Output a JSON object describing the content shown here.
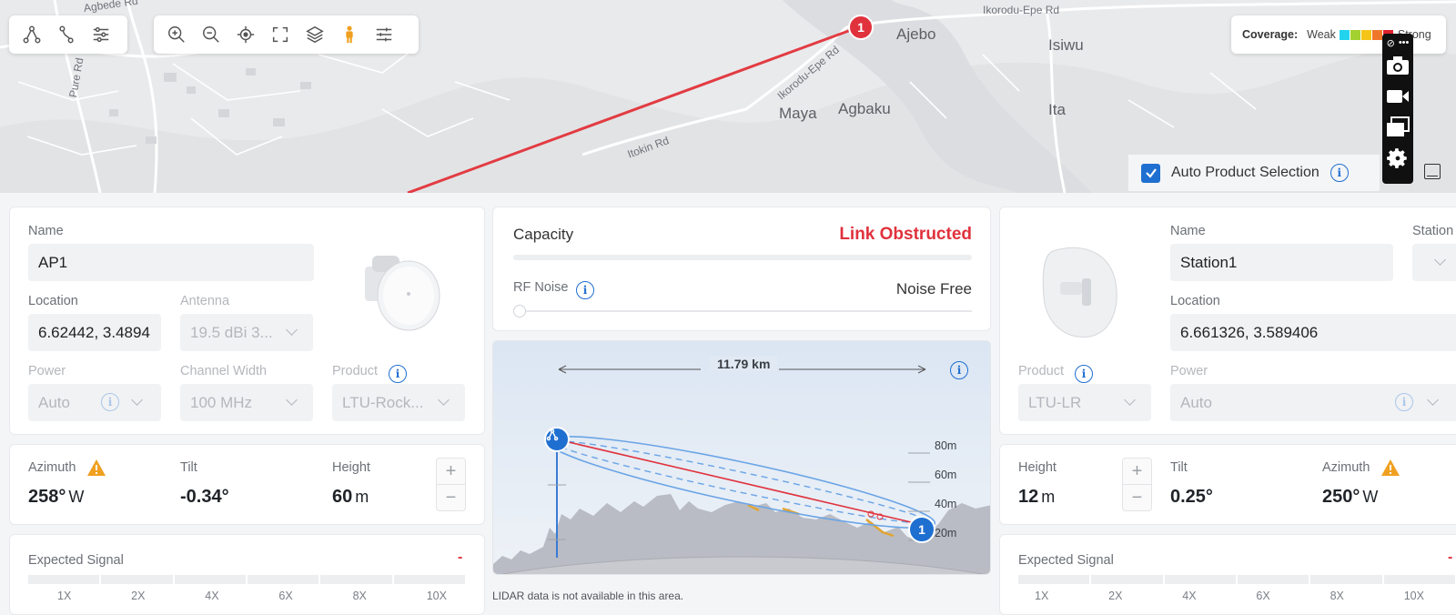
{
  "map": {
    "places": [
      "Ajebo",
      "Isiwu",
      "Maya",
      "Agbaku",
      "Ita"
    ],
    "roads": [
      "Ikorodu-Epe Rd",
      "Ikorodu-Epe Rd",
      "Itokin Rd",
      "Agbede Rd",
      "Pure Rd"
    ],
    "marker": "1"
  },
  "toolbar_left": {
    "icons": [
      "network-icon",
      "link-icon",
      "filter-icon"
    ]
  },
  "toolbar_right": {
    "icons": [
      "zoom-in-icon",
      "zoom-out-icon",
      "locate-icon",
      "fullscreen-icon",
      "layers-icon",
      "street-view-icon",
      "settings-sliders-icon"
    ]
  },
  "coverage": {
    "title": "Coverage:",
    "weak": "Weak",
    "strong": "Strong",
    "colors": [
      "#22d3ee",
      "#a3d12f",
      "#f5c518",
      "#f0772a",
      "#e0222b"
    ]
  },
  "auto_product": {
    "label": "Auto Product Selection",
    "checked": true
  },
  "ap": {
    "name_label": "Name",
    "name": "AP1",
    "location_label": "Location",
    "location": "6.62442, 3.4894",
    "antenna_label": "Antenna",
    "antenna": "19.5 dBi 3...",
    "power_label": "Power",
    "power": "Auto",
    "channel_label": "Channel Width",
    "channel": "100 MHz",
    "product_label": "Product",
    "product": "LTU-Rock...",
    "azimuth_label": "Azimuth",
    "azimuth": "258°",
    "azimuth_dir": "W",
    "tilt_label": "Tilt",
    "tilt": "-0.34°",
    "height_label": "Height",
    "height": "60",
    "height_unit": "m",
    "signal_label": "Expected Signal",
    "signal_value": "-",
    "ticks": [
      "1X",
      "2X",
      "4X",
      "6X",
      "8X",
      "10X"
    ]
  },
  "link": {
    "capacity_label": "Capacity",
    "status": "Link Obstructed",
    "rf_noise_label": "RF Noise",
    "rf_noise_value": "Noise Free",
    "distance": "11.79 km",
    "elevations": [
      "80m",
      "60m",
      "40m",
      "20m"
    ],
    "station_marker": "1",
    "lidar_note": "LIDAR data is not available in this area."
  },
  "station": {
    "name_label": "Name",
    "name": "Station1",
    "extra_label": "Station",
    "location_label": "Location",
    "location": "6.661326, 3.589406",
    "product_label": "Product",
    "product": "LTU-LR",
    "power_label": "Power",
    "power": "Auto",
    "height_label": "Height",
    "height": "12",
    "height_unit": "m",
    "tilt_label": "Tilt",
    "tilt": "0.25°",
    "azimuth_label": "Azimuth",
    "azimuth": "250°",
    "azimuth_dir": "W",
    "signal_label": "Expected Signal",
    "signal_value": "-",
    "ticks": [
      "1X",
      "2X",
      "4X",
      "6X",
      "8X",
      "10X"
    ]
  }
}
